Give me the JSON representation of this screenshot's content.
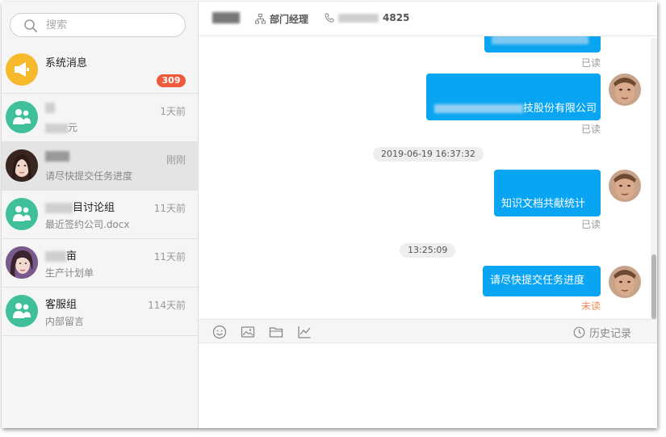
{
  "search": {
    "placeholder": "搜索"
  },
  "conversations": [
    {
      "name": "系统消息",
      "time": "",
      "preview": "",
      "badge": "309"
    },
    {
      "name": "",
      "time": "1天前",
      "preview": "元"
    },
    {
      "name": "",
      "time": "刚刚",
      "preview": "请尽快提交任务进度"
    },
    {
      "name": "目讨论组",
      "time": "11天前",
      "preview": "最近签约公司.docx"
    },
    {
      "name": "亩",
      "time": "11天前",
      "preview": "生产计划单"
    },
    {
      "name": "客服组",
      "time": "114天前",
      "preview": "内部留言"
    }
  ],
  "header": {
    "role": "部门经理",
    "phone_suffix": "4825"
  },
  "messages": [
    {
      "text": "",
      "status": "已读"
    },
    {
      "text": "技股份有限公司",
      "status": "已读"
    },
    {
      "time": "2019-06-19 16:37:32"
    },
    {
      "text": "知识文档共献统计",
      "status": "已读"
    },
    {
      "time": "13:25:09"
    },
    {
      "text": "请尽快提交任务进度",
      "status": "未读"
    }
  ],
  "toolbar": {
    "history": "历史记录"
  },
  "colors": {
    "accent_blue": "#0aa5f2",
    "badge_red": "#f05a3c",
    "group_green": "#3fbf9a",
    "system_yellow": "#f7b92c",
    "unread_orange": "#f28a52"
  },
  "icons": [
    "search-icon",
    "megaphone-icon",
    "group-icon",
    "org-chart-icon",
    "phone-icon",
    "emoji-icon",
    "image-icon",
    "folder-icon",
    "chart-icon",
    "clock-icon"
  ]
}
